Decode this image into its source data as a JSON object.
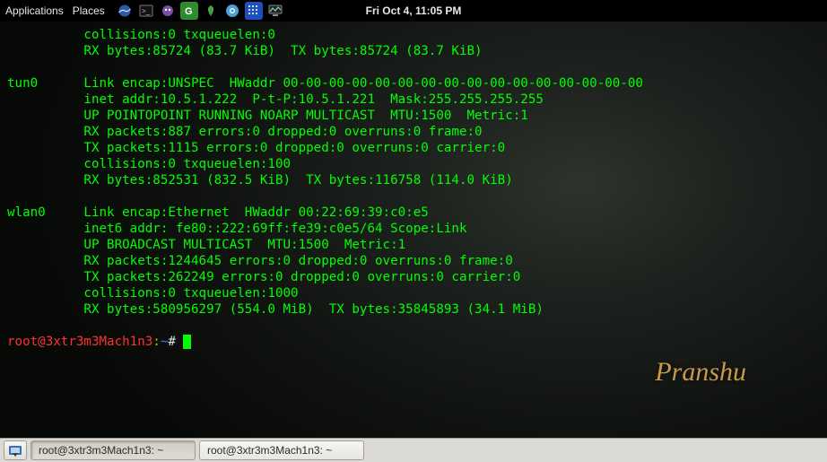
{
  "panel": {
    "menus": [
      "Applications",
      "Places"
    ],
    "clock": "Fri Oct  4, 11:05 PM",
    "launchers": [
      {
        "name": "iceweasel-icon"
      },
      {
        "name": "terminal-icon"
      },
      {
        "name": "pidgin-icon"
      },
      {
        "name": "greenbone-icon"
      },
      {
        "name": "leaf-icon"
      },
      {
        "name": "chromium-icon"
      },
      {
        "name": "grid-icon"
      },
      {
        "name": "monitor-icon"
      }
    ]
  },
  "terminal": {
    "lines": [
      "          collisions:0 txqueuelen:0 ",
      "          RX bytes:85724 (83.7 KiB)  TX bytes:85724 (83.7 KiB)",
      "",
      "tun0      Link encap:UNSPEC  HWaddr 00-00-00-00-00-00-00-00-00-00-00-00-00-00-00-00  ",
      "          inet addr:10.5.1.222  P-t-P:10.5.1.221  Mask:255.255.255.255",
      "          UP POINTOPOINT RUNNING NOARP MULTICAST  MTU:1500  Metric:1",
      "          RX packets:887 errors:0 dropped:0 overruns:0 frame:0",
      "          TX packets:1115 errors:0 dropped:0 overruns:0 carrier:0",
      "          collisions:0 txqueuelen:100 ",
      "          RX bytes:852531 (832.5 KiB)  TX bytes:116758 (114.0 KiB)",
      "",
      "wlan0     Link encap:Ethernet  HWaddr 00:22:69:39:c0:e5  ",
      "          inet6 addr: fe80::222:69ff:fe39:c0e5/64 Scope:Link",
      "          UP BROADCAST MULTICAST  MTU:1500  Metric:1",
      "          RX packets:1244645 errors:0 dropped:0 overruns:0 frame:0",
      "          TX packets:262249 errors:0 dropped:0 overruns:0 carrier:0",
      "          collisions:0 txqueuelen:1000 ",
      "          RX bytes:580956297 (554.0 MiB)  TX bytes:35845893 (34.1 MiB)",
      ""
    ],
    "prompt": {
      "user": "root@3xtr3m3Mach1n3",
      "sep": ":",
      "path": "~",
      "hash": "# "
    }
  },
  "wallpaper": {
    "signature": "Pranshu"
  },
  "taskbar": {
    "items": [
      {
        "label": "root@3xtr3m3Mach1n3: ~",
        "active": true
      },
      {
        "label": "root@3xtr3m3Mach1n3: ~",
        "active": false
      }
    ]
  }
}
